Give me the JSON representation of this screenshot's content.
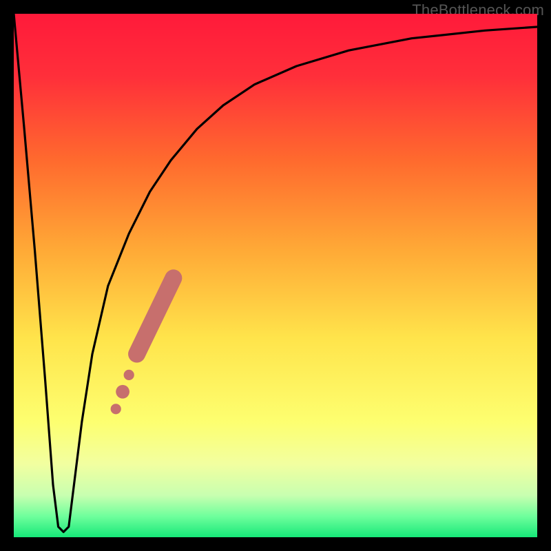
{
  "attribution": "TheBottleneck.com",
  "colors": {
    "frame": "#000000",
    "gradient_stops": [
      {
        "offset": 0.0,
        "color": "#ff1a3a"
      },
      {
        "offset": 0.12,
        "color": "#ff2f3a"
      },
      {
        "offset": 0.28,
        "color": "#ff6a2e"
      },
      {
        "offset": 0.45,
        "color": "#ffa936"
      },
      {
        "offset": 0.62,
        "color": "#ffe44b"
      },
      {
        "offset": 0.78,
        "color": "#fdff70"
      },
      {
        "offset": 0.86,
        "color": "#f2ffa0"
      },
      {
        "offset": 0.92,
        "color": "#c8ffb0"
      },
      {
        "offset": 0.96,
        "color": "#6fff9c"
      },
      {
        "offset": 1.0,
        "color": "#16e879"
      }
    ],
    "curve": "#000000",
    "marker": "#c76f6d"
  },
  "chart_data": {
    "type": "line",
    "title": "",
    "xlabel": "",
    "ylabel": "",
    "xlim": [
      0,
      100
    ],
    "ylim": [
      0,
      100
    ],
    "series": [
      {
        "name": "bottleneck-curve",
        "x": [
          0,
          2,
          4,
          6,
          7.5,
          8.5,
          9.5,
          10.5,
          11.5,
          13,
          15,
          18,
          22,
          26,
          30,
          35,
          40,
          46,
          54,
          64,
          76,
          90,
          100
        ],
        "y": [
          100,
          78,
          55,
          30,
          10,
          2,
          1,
          2,
          10,
          22,
          35,
          48,
          58,
          66,
          72,
          78,
          82.5,
          86.5,
          90,
          93,
          95.3,
          96.8,
          97.5
        ]
      }
    ],
    "markers": {
      "name": "highlight-segment",
      "points": [
        {
          "x": 19.5,
          "y": 24.5,
          "r": 1.0
        },
        {
          "x": 20.8,
          "y": 27.8,
          "r": 1.3
        },
        {
          "x": 22.0,
          "y": 31.0,
          "r": 1.0
        },
        {
          "x": 23.5,
          "y": 35.0,
          "r": 1.6
        },
        {
          "x": 30.5,
          "y": 49.5,
          "r": 1.6
        }
      ],
      "thick_segment": {
        "x1": 23.5,
        "y1": 35.0,
        "x2": 30.5,
        "y2": 49.5,
        "width": 3.3
      }
    }
  }
}
